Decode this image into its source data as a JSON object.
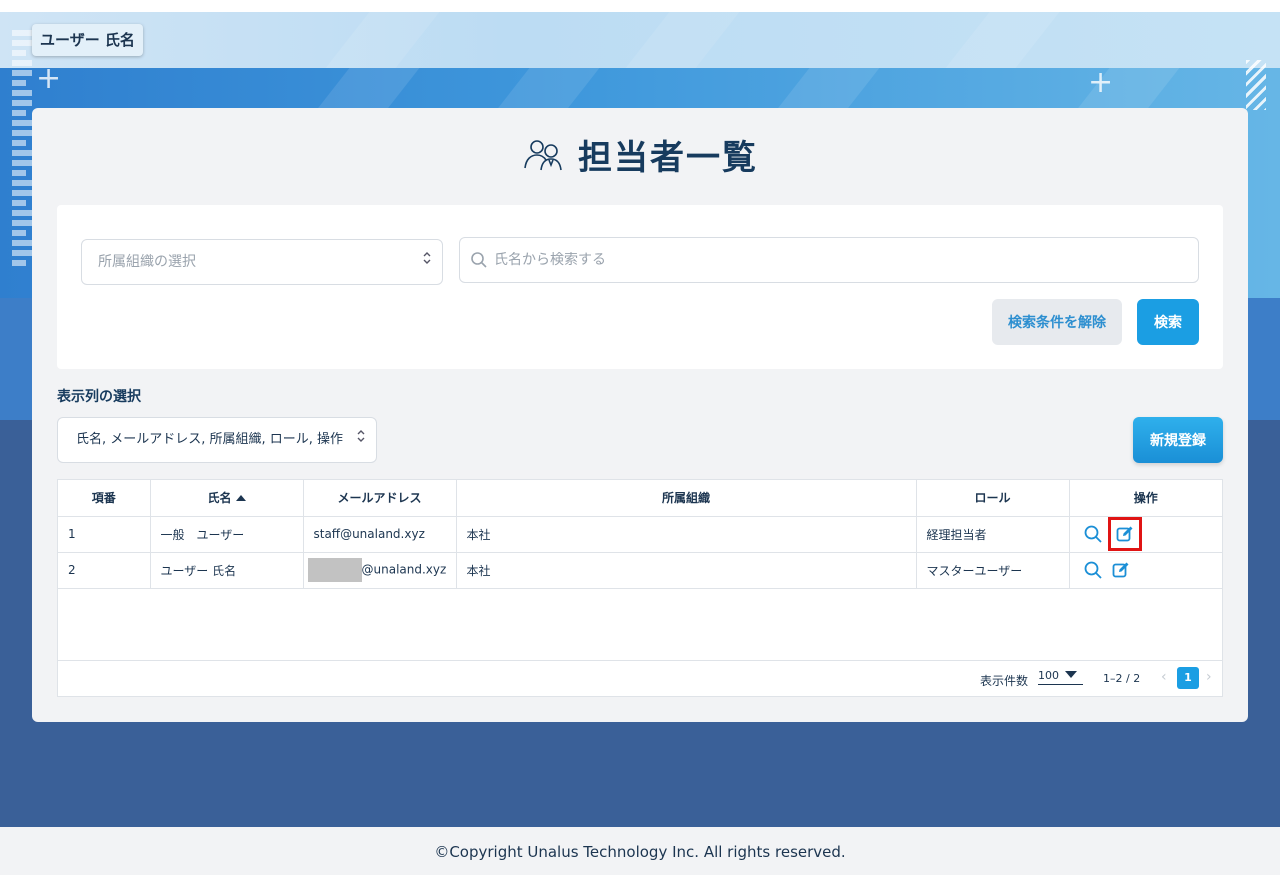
{
  "header": {
    "user_name": "ユーザー 氏名"
  },
  "page": {
    "title": "担当者一覧",
    "title_icon": "people-icon"
  },
  "filters": {
    "org_select_placeholder": "所属組織の選択",
    "search_placeholder": "氏名から検索する",
    "clear_label": "検索条件を解除",
    "search_label": "検索"
  },
  "columns_select": {
    "label": "表示列の選択",
    "value": "氏名, メールアドレス, 所属組織, ロール, 操作"
  },
  "new_button_label": "新規登録",
  "table": {
    "headers": [
      "項番",
      "氏名",
      "メールアドレス",
      "所属組織",
      "ロール",
      "操作"
    ],
    "sorted_column": "氏名",
    "rows": [
      {
        "no": "1",
        "name": "一般　ユーザー",
        "email": "staff@unaland.xyz",
        "org": "本社",
        "role": "経理担当者"
      },
      {
        "no": "2",
        "name": "ユーザー 氏名",
        "email": "@unaland.xyz",
        "org": "本社",
        "role": "マスターユーザー"
      }
    ]
  },
  "pagination": {
    "per_page_label": "表示件数",
    "per_page_value": "100",
    "range": "1–2 / 2",
    "current_page": "1"
  },
  "footer": {
    "copyright": "©Copyright Unalus Technology Inc. All rights reserved."
  },
  "colors": {
    "accent": "#1b9ee3",
    "heading": "#173b5e",
    "highlight": "#e01414"
  }
}
